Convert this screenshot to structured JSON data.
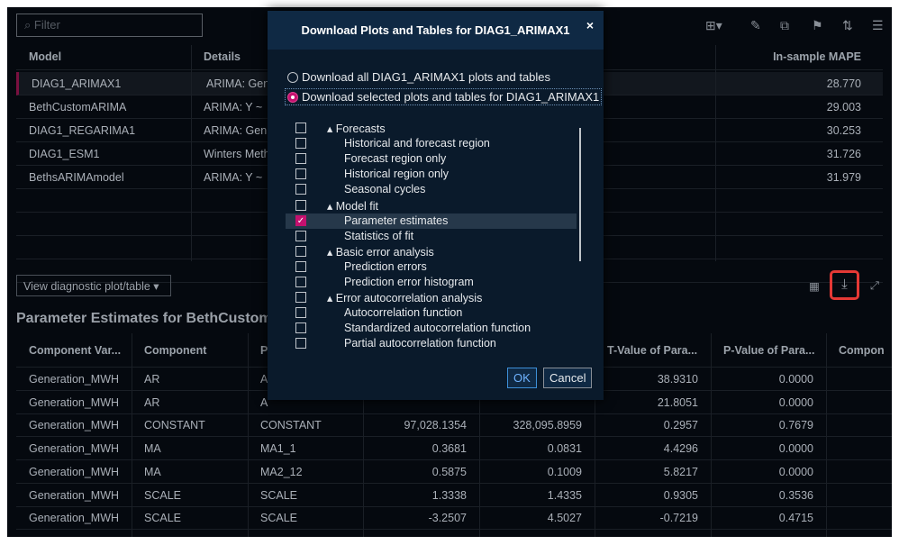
{
  "filter": {
    "placeholder": "Filter"
  },
  "models": {
    "headers": [
      "Model",
      "Details",
      "In-sample MAPE"
    ],
    "rows": [
      [
        "DIAG1_ARIMAX1",
        "ARIMA: Gen",
        "28.770"
      ],
      [
        "BethCustomARIMA",
        "ARIMA: Y ~",
        "29.003"
      ],
      [
        "DIAG1_REGARIMA1",
        "ARIMA: Gen",
        "30.253"
      ],
      [
        "DIAG1_ESM1",
        "Winters Meth",
        "31.726"
      ],
      [
        "BethsARIMAmodel",
        "ARIMA: Y ~",
        "31.979"
      ]
    ]
  },
  "view_select": "View diagnostic plot/table ▾",
  "param_title": "Parameter Estimates for BethCustom",
  "params": {
    "headers": [
      "Component Var...",
      "Component",
      "P",
      "",
      "",
      "T-Value of Para...",
      "P-Value of Para...",
      "Compon"
    ],
    "rows": [
      [
        "Generation_MWH",
        "AR",
        "A",
        "",
        "",
        "38.9310",
        "0.0000"
      ],
      [
        "Generation_MWH",
        "AR",
        "A",
        "",
        "",
        "21.8051",
        "0.0000"
      ],
      [
        "Generation_MWH",
        "CONSTANT",
        "CONSTANT",
        "97,028.1354",
        "328,095.8959",
        "0.2957",
        "0.7679"
      ],
      [
        "Generation_MWH",
        "MA",
        "MA1_1",
        "0.3681",
        "0.0831",
        "4.4296",
        "0.0000"
      ],
      [
        "Generation_MWH",
        "MA",
        "MA2_12",
        "0.5875",
        "0.1009",
        "5.8217",
        "0.0000"
      ],
      [
        "Generation_MWH",
        "SCALE",
        "SCALE",
        "1.3338",
        "1.4335",
        "0.9305",
        "0.3536"
      ],
      [
        "Generation_MWH",
        "SCALE",
        "SCALE",
        "-3.2507",
        "4.5027",
        "-0.7219",
        "0.4715"
      ]
    ]
  },
  "dialog": {
    "title": "Download Plots and Tables for DIAG1_ARIMAX1",
    "close": "×",
    "option_all": "Download all DIAG1_ARIMAX1 plots and tables",
    "option_selected": "Download selected plots and tables for DIAG1_ARIMAX1",
    "items": [
      {
        "label": "▴ Forecasts",
        "group": true,
        "checked": false
      },
      {
        "label": "Historical and forecast region",
        "checked": false
      },
      {
        "label": "Forecast region only",
        "checked": false
      },
      {
        "label": "Historical region only",
        "checked": false
      },
      {
        "label": "Seasonal cycles",
        "checked": false
      },
      {
        "label": "▴ Model fit",
        "group": true,
        "checked": false
      },
      {
        "label": "Parameter estimates",
        "checked": true
      },
      {
        "label": "Statistics of fit",
        "checked": false
      },
      {
        "label": "▴ Basic error analysis",
        "group": true,
        "checked": false
      },
      {
        "label": "Prediction errors",
        "checked": false
      },
      {
        "label": "Prediction error histogram",
        "checked": false
      },
      {
        "label": "▴ Error autocorrelation analysis",
        "group": true,
        "checked": false
      },
      {
        "label": "Autocorrelation function",
        "checked": false
      },
      {
        "label": "Standardized autocorrelation function",
        "checked": false
      },
      {
        "label": "Partial autocorrelation function",
        "checked": false
      }
    ],
    "ok": "OK",
    "cancel": "Cancel"
  },
  "colors": {
    "accent": "#c5116f",
    "highlight": "#e53935"
  }
}
